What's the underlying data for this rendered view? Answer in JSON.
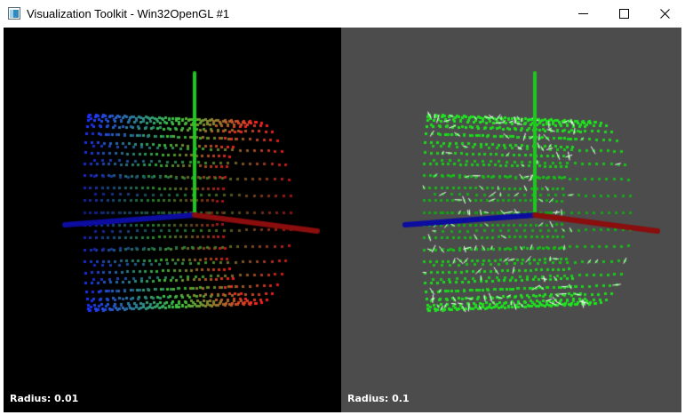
{
  "window": {
    "title": "Visualization Toolkit - Win32OpenGL #1",
    "icon": "vtk-window-icon",
    "controls": {
      "minimize": "minimize-icon",
      "maximize": "maximize-icon",
      "close": "close-icon"
    }
  },
  "viewports": [
    {
      "label": "Radius: 0.01",
      "background": "#000000",
      "point_coloring": "scalar-gradient",
      "colors": {
        "low": "#1f33ff",
        "mid": "#3ccc3c",
        "high": "#ff2020"
      },
      "glyphs": "none"
    },
    {
      "label": "Radius: 0.1",
      "background": "#4c4c4c",
      "point_coloring": "solid",
      "colors": {
        "points": "#1ee61e",
        "glyphs": "#ffffff"
      },
      "glyphs": "short-white-lines"
    }
  ],
  "axes": {
    "x_color": "#8b0d0d",
    "y_color": "#1ec81e",
    "z_color": "#0c0ca0"
  }
}
